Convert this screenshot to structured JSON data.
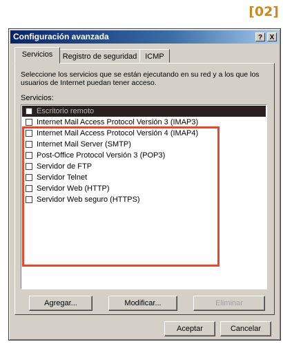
{
  "caption": "[02]",
  "window": {
    "title": "Configuración avanzada",
    "help_label": "?",
    "close_label": "X"
  },
  "tabs": [
    {
      "label": "Servicios",
      "active": true
    },
    {
      "label": "Registro de seguridad",
      "active": false
    },
    {
      "label": "ICMP",
      "active": false
    }
  ],
  "description": "Seleccione los servicios que se están ejecutando en su red y a los que los usuarios de Internet puedan tener acceso.",
  "services_label": "Servicios:",
  "services": [
    {
      "label": "Escritorio remoto",
      "checked": false,
      "selected": true
    },
    {
      "label": "Internet Mail Access Protocol Versión 3 (IMAP3)",
      "checked": false
    },
    {
      "label": "Internet Mail Access Protocol Versión 4 (IMAP4)",
      "checked": false
    },
    {
      "label": "Internet Mail Server (SMTP)",
      "checked": false
    },
    {
      "label": "Post-Office Protocol Versión 3 (POP3)",
      "checked": false
    },
    {
      "label": "Servidor de FTP",
      "checked": false
    },
    {
      "label": "Servidor Telnet",
      "checked": false
    },
    {
      "label": "Servidor Web (HTTP)",
      "checked": false
    },
    {
      "label": "Servidor Web seguro (HTTPS)",
      "checked": false
    }
  ],
  "buttons": {
    "add": "Agregar...",
    "modify": "Modificar...",
    "delete": "Eliminar",
    "ok": "Aceptar",
    "cancel": "Cancelar"
  },
  "colors": {
    "title_start": "#0a246a",
    "highlight_frame": "#e8472e",
    "caption": "#c98b1f"
  }
}
